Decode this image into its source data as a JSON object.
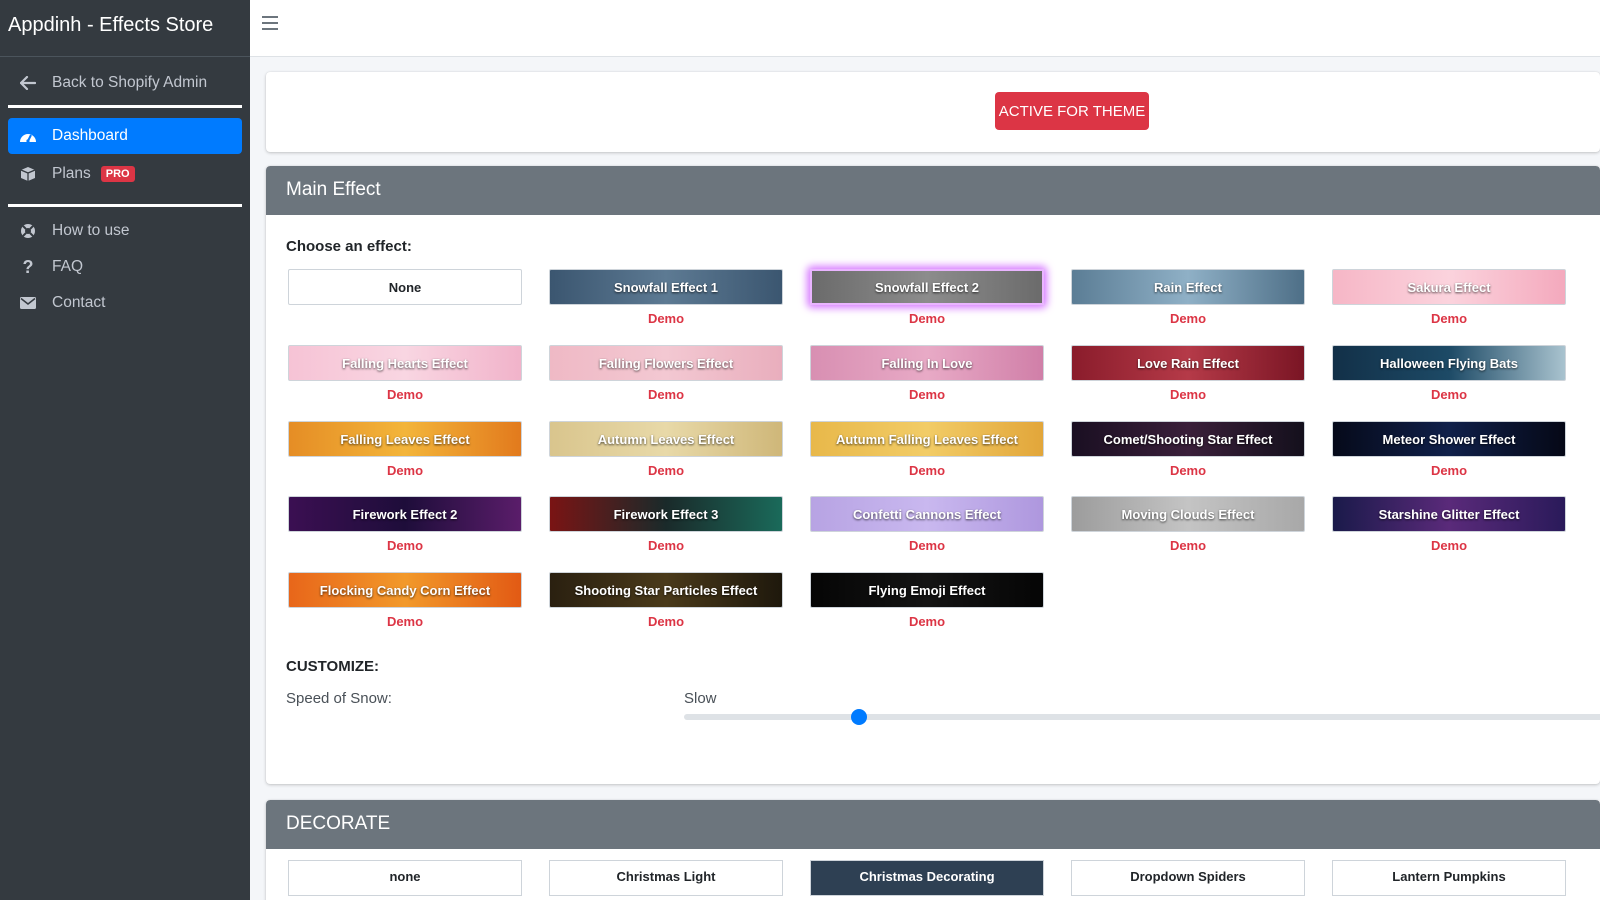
{
  "app": {
    "title": "Appdinh - Effects Store"
  },
  "sidebar": {
    "back": {
      "label": "Back to Shopify Admin",
      "icon": "arrow-left-icon"
    },
    "items": [
      {
        "label": "Dashboard",
        "icon": "dashboard-icon",
        "active": true
      },
      {
        "label": "Plans",
        "icon": "box-icon",
        "badge": "PRO"
      },
      {
        "label": "How to use",
        "icon": "life-ring-icon"
      },
      {
        "label": "FAQ",
        "icon": "question-icon"
      },
      {
        "label": "Contact",
        "icon": "envelope-icon"
      }
    ]
  },
  "topbar": {
    "menu_icon": "hamburger-icon"
  },
  "active_button": {
    "label": "ACTIVE FOR THEME",
    "color": "#dc3545"
  },
  "main_effect": {
    "header": "Main Effect",
    "choose_label": "Choose an effect:",
    "demo_label": "Demo",
    "effects": [
      {
        "label": "None",
        "bg": "#ffffff",
        "plain": true,
        "demo": false
      },
      {
        "label": "Snowfall Effect 1",
        "bg": "linear-gradient(90deg,#3b5670,#5d7a93,#3b5670)"
      },
      {
        "label": "Snowfall Effect 2",
        "bg": "linear-gradient(90deg,#6b6b6b,#8c8c8c,#6b6b6b)",
        "selected": true
      },
      {
        "label": "Rain Effect",
        "bg": "linear-gradient(90deg,#5b7d95,#8fb0c6,#4e6f87)"
      },
      {
        "label": "Sakura Effect",
        "bg": "linear-gradient(90deg,#f6b6c6,#fbd3dd,#f4a9bd)"
      },
      {
        "label": "Falling Hearts Effect",
        "bg": "linear-gradient(90deg,#f6c3d5,#f9d6e2,#f1b3ca)"
      },
      {
        "label": "Falling Flowers Effect",
        "bg": "linear-gradient(90deg,#efb9c5,#f3c8d2,#e9aebd)"
      },
      {
        "label": "Falling In Love",
        "bg": "linear-gradient(90deg,#d88fb2,#e8aac6,#d07fa8)"
      },
      {
        "label": "Love Rain Effect",
        "bg": "linear-gradient(90deg,#8a1c2b,#b53a48,#7a1524)"
      },
      {
        "label": "Halloween Flying Bats",
        "bg": "linear-gradient(90deg,#123048,#1d4a66,#a9c3cf)"
      },
      {
        "label": "Falling Leaves Effect",
        "bg": "linear-gradient(90deg,#e58d25,#f3b53a,#e27a1d)"
      },
      {
        "label": "Autumn Leaves Effect",
        "bg": "linear-gradient(90deg,#d9c58d,#e8d9a8,#cfb779)"
      },
      {
        "label": "Autumn Falling Leaves Effect",
        "bg": "linear-gradient(90deg,#e8b84a,#f2cc66,#e2a63a)"
      },
      {
        "label": "Comet/Shooting Star Effect",
        "bg": "linear-gradient(90deg,#1a0f22,#3a1f3a,#14101c)"
      },
      {
        "label": "Meteor Shower Effect",
        "bg": "linear-gradient(90deg,#060a1a,#10204a,#050816)"
      },
      {
        "label": "Firework Effect 2",
        "bg": "linear-gradient(90deg,#3b0f52,#1e0d3a,#5a1d6a)"
      },
      {
        "label": "Firework Effect 3",
        "bg": "linear-gradient(90deg,#7a1414,#1a2a2a,#1a6a5a)"
      },
      {
        "label": "Confetti Cannons Effect",
        "bg": "linear-gradient(90deg,#b7a3e3,#c9b8ef,#ae97de)"
      },
      {
        "label": "Moving Clouds Effect",
        "bg": "linear-gradient(90deg,#9c9c9c,#c4c4c4,#a8a8a8)"
      },
      {
        "label": "Starshine Glitter Effect",
        "bg": "linear-gradient(90deg,#1a1a4a,#5a2a7a,#2a1a5a)"
      },
      {
        "label": "Flocking Candy Corn Effect",
        "bg": "linear-gradient(90deg,#e8661a,#f2992a,#e25a14)"
      },
      {
        "label": "Shooting Star Particles Effect",
        "bg": "linear-gradient(90deg,#2a2010,#4a3a1a,#1e180c)"
      },
      {
        "label": "Flying Emoji Effect",
        "bg": "linear-gradient(90deg,#050505,#141414,#050505)"
      }
    ],
    "customize_label": "CUSTOMIZE:",
    "speed_label": "Speed of Snow:",
    "speed_value": "Slow",
    "speed_level": 0.19
  },
  "decorate": {
    "header": "DECORATE",
    "items": [
      {
        "label": "none",
        "dark": false
      },
      {
        "label": "Christmas Light",
        "dark": false
      },
      {
        "label": "Christmas Decorating",
        "dark": true
      },
      {
        "label": "Dropdown Spiders",
        "dark": false
      },
      {
        "label": "Lantern Pumpkins",
        "dark": false
      }
    ]
  }
}
